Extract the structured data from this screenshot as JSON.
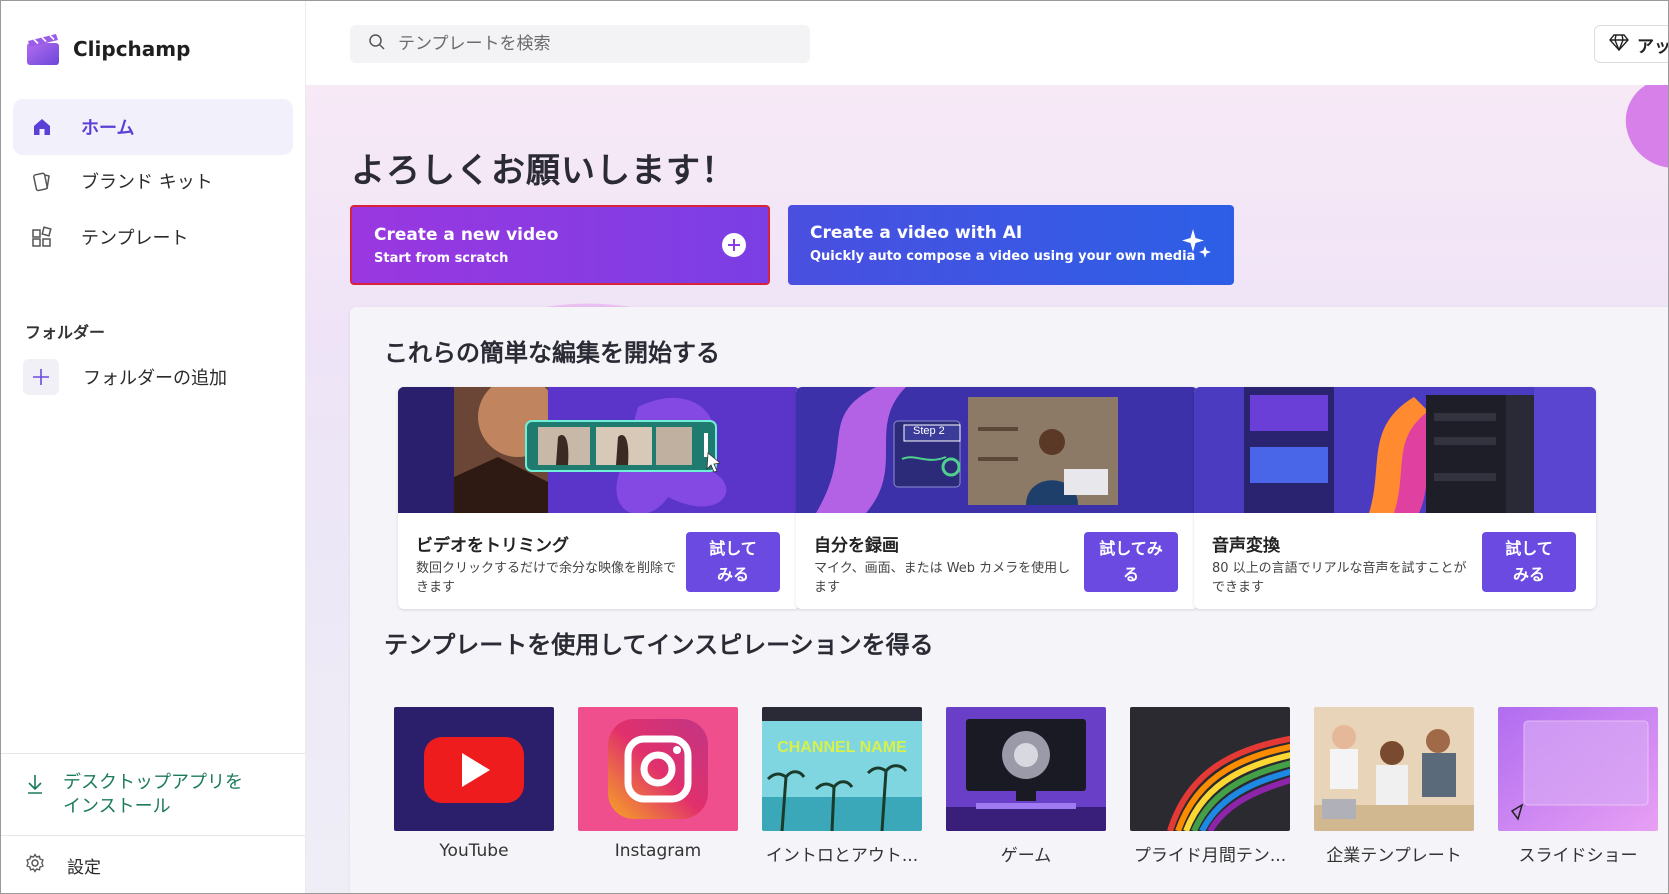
{
  "app": {
    "name": "Clipchamp"
  },
  "sidebar": {
    "items": [
      {
        "label": "ホーム",
        "icon": "home-icon",
        "active": true
      },
      {
        "label": "ブランド キット",
        "icon": "brand-kit-icon"
      },
      {
        "label": "テンプレート",
        "icon": "templates-icon"
      }
    ],
    "folder_title": "フォルダー",
    "add_folder": "フォルダーの追加",
    "install_line1": "デスクトップアプリを",
    "install_line2": "インストール",
    "settings": "設定"
  },
  "topbar": {
    "search_placeholder": "テンプレートを検索",
    "upgrade_label": "アッ"
  },
  "main": {
    "greeting": "よろしくお願いします！",
    "cta_new": {
      "title": "Create a new video",
      "subtitle": "Start from scratch"
    },
    "cta_ai": {
      "title": "Create a video with AI",
      "subtitle": "Quickly auto compose a video using your own media"
    },
    "edits_title": "これらの簡単な編集を開始する",
    "edits": [
      {
        "title": "ビデオをトリミング",
        "desc": "数回クリックするだけで余分な映像を削除できます",
        "button_line1": "試して",
        "button_line2": "みる"
      },
      {
        "title": "自分を録画",
        "desc": "マイク、画面、または Web カメラを使用します",
        "button_line1": "試してみ",
        "button_line2": "る",
        "thumb_step": "Step 2"
      },
      {
        "title": "音声変換",
        "desc": "80 以上の言語でリアルな音声を試すことができます",
        "button_line1": "試して",
        "button_line2": "みる"
      }
    ],
    "templates_title": "テンプレートを使用してインスピレーションを得る",
    "templates": [
      {
        "label": "YouTube"
      },
      {
        "label": "Instagram"
      },
      {
        "label": "イントロとアウト...",
        "thumb_text": "CHANNEL NAME"
      },
      {
        "label": "ゲーム"
      },
      {
        "label": "プライド月間テン..."
      },
      {
        "label": "企業テンプレート"
      },
      {
        "label": "スライドショー"
      }
    ]
  },
  "colors": {
    "accent": "#6a4ae0",
    "cta_new": "#8b3ce2",
    "cta_ai": "#3b57e4",
    "install": "#1c7a5c"
  }
}
